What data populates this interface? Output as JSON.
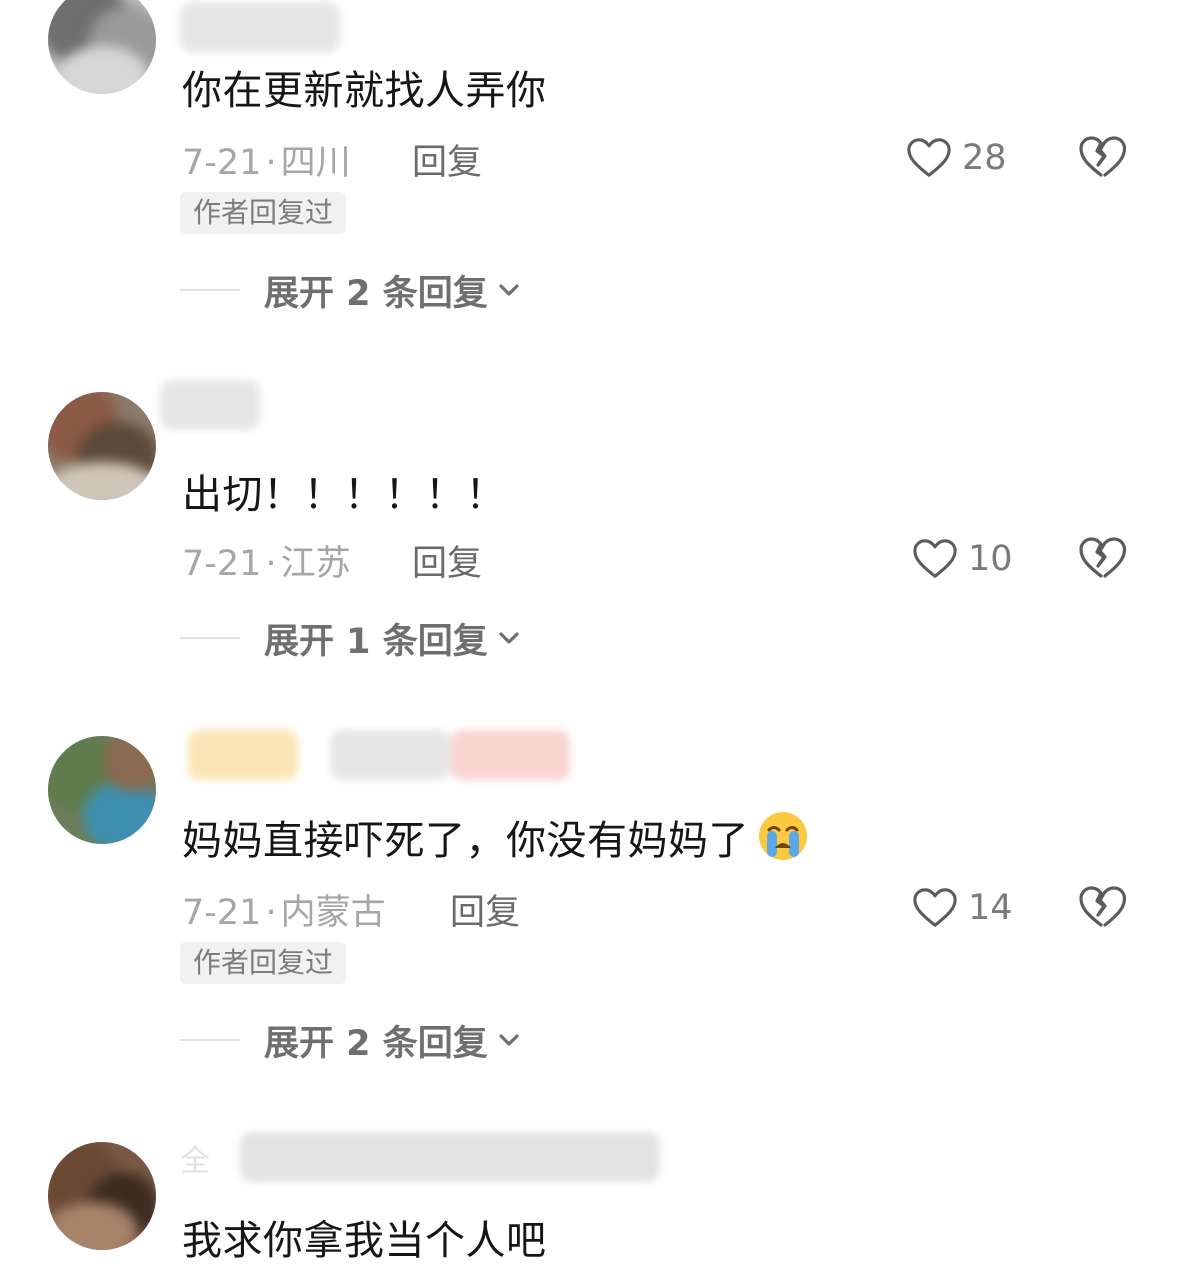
{
  "comments": [
    {
      "username": "",
      "text": "你在更新就找人弄你",
      "date": "7-21",
      "location": "四川",
      "reply_label": "回复",
      "likes": "28",
      "author_replied": "作者回复过",
      "expand_label": "展开 2 条回复",
      "avatar_colors": [
        "#6f6f6f",
        "#9a9a9a",
        "#d7d7d7"
      ]
    },
    {
      "username": "",
      "text": "出切！！！！！！",
      "date": "7-21",
      "location": "江苏",
      "reply_label": "回复",
      "likes": "10",
      "author_replied": "",
      "expand_label": "展开 1 条回复",
      "avatar_colors": [
        "#8a5a45",
        "#5c4a3a",
        "#cfc5b8"
      ]
    },
    {
      "username": "",
      "text": "妈妈直接吓死了，你没有妈妈了",
      "date": "7-21",
      "location": "内蒙古",
      "reply_label": "回复",
      "likes": "14",
      "author_replied": "作者回复过",
      "expand_label": "展开 2 条回复",
      "emoji": "loudly-crying-face",
      "avatar_colors": [
        "#5f7d4c",
        "#3f8fb0",
        "#8a6a50"
      ]
    },
    {
      "username": "全",
      "text": "我求你拿我当个人吧",
      "avatar_colors": [
        "#6b4a35",
        "#3d2c22",
        "#a7836a"
      ]
    }
  ],
  "icons": {
    "like": "heart-outline-icon",
    "dislike": "broken-heart-icon",
    "expand": "chevron-down-icon"
  },
  "colors": {
    "primary_text": "#161616",
    "secondary_text": "#a6a6a6",
    "action_text": "#6a6a6a",
    "badge_bg": "#f1f1f1",
    "icon_stroke": "#5b5b5b"
  }
}
